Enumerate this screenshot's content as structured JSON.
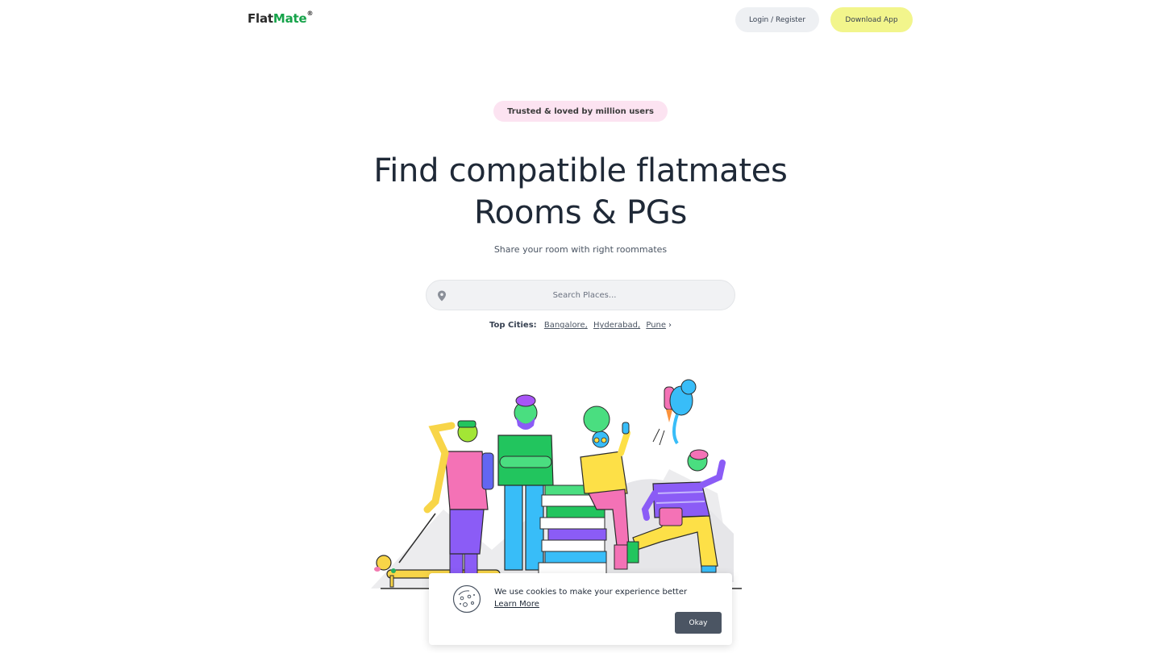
{
  "header": {
    "logo_part1": "Flat",
    "logo_part2": "Mate",
    "logo_mark": "®",
    "login_label": "Login / Register",
    "download_label": "Download App"
  },
  "hero": {
    "badge": "Trusted & loved by million users",
    "headline_line1": "Find compatible flatmates",
    "headline_line2": "Rooms & PGs",
    "subtitle": "Share your room with right roommates"
  },
  "search": {
    "placeholder": "Search Places...",
    "icon": "location-pin-icon"
  },
  "top_cities": {
    "label": "Top Cities:",
    "cities": [
      "Bangalore,",
      "Hyderabad,",
      "Pune"
    ]
  },
  "cookie": {
    "message": "We use cookies to make your experience better",
    "learn_more": "Learn More",
    "okay_label": "Okay"
  },
  "colors": {
    "brand_green": "#16a34a",
    "download_bg": "#f2f58c",
    "badge_bg": "#fce3f1",
    "login_bg": "#eef0f3",
    "okay_bg": "#4b5563"
  }
}
